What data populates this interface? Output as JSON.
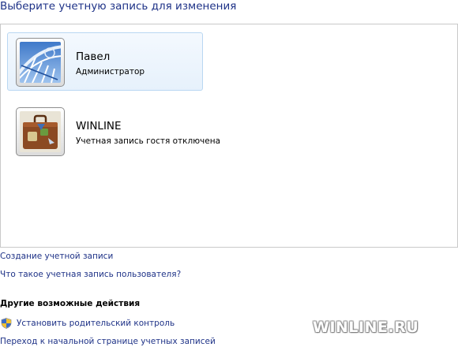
{
  "title": "Выберите учетную запись для изменения",
  "accounts": [
    {
      "name": "Павел",
      "role": "Администратор",
      "selected": true,
      "avatar_icon": "skatepark-picture-icon"
    },
    {
      "name": "WINLINE",
      "role": "Учетная запись гостя отключена",
      "selected": false,
      "avatar_icon": "suitcase-picture-icon"
    }
  ],
  "links": {
    "create_account": "Создание учетной записи",
    "what_is_account": "Что такое учетная запись пользователя?"
  },
  "other_actions": {
    "title": "Другие возможные действия",
    "parental_control": "Установить родительский контроль",
    "go_home": "Переход к начальной странице учетных записей"
  },
  "watermark": "WINLINE.RU",
  "colors": {
    "link": "#1e3287",
    "selection_bg": "#e6f1fc",
    "selection_border": "#b9d7f2"
  }
}
